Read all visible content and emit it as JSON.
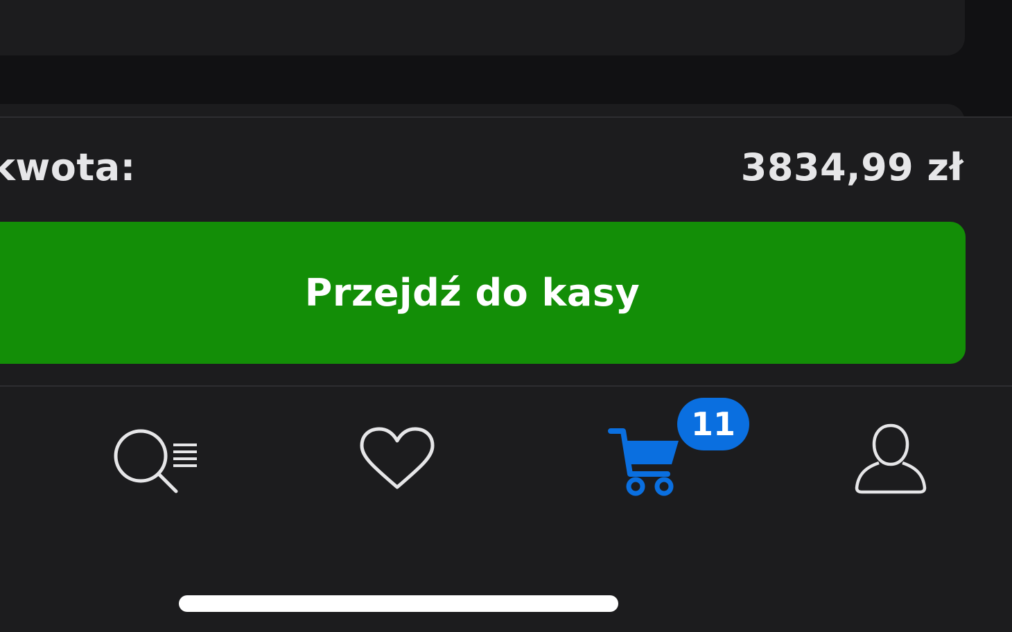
{
  "summary": {
    "total_label": "kwota:",
    "total_value": "3834,99 zł",
    "checkout_button_label": "Przejdź do kasy"
  },
  "tab_bar": {
    "tabs": [
      {
        "name": "search",
        "icon": "search-list-icon",
        "active": false
      },
      {
        "name": "favorites",
        "icon": "heart-icon",
        "active": false
      },
      {
        "name": "cart",
        "icon": "cart-icon",
        "active": true
      },
      {
        "name": "account",
        "icon": "user-icon",
        "active": false
      }
    ],
    "cart_badge": "11"
  },
  "colors": {
    "background": "#1c1c1e",
    "checkout_button": "#138e07",
    "active_tab": "#0a6fe0",
    "inactive_tab": "#e6e6e8",
    "badge": "#0a6fe0"
  }
}
